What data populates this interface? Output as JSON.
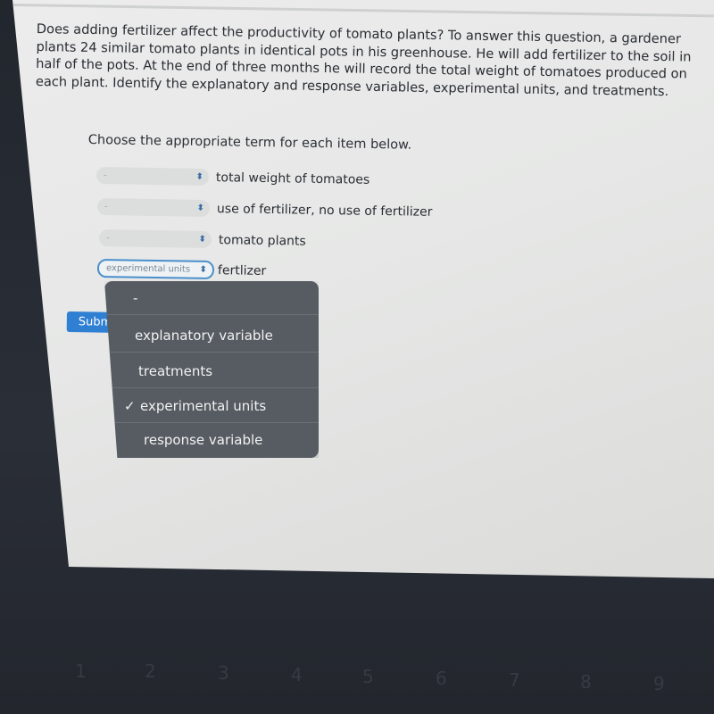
{
  "question": {
    "text": "Does adding fertilizer affect the productivity of tomato plants? To answer this question, a gardener plants 24 similar tomato plants in identical pots in his greenhouse. He will add fertilizer to the soil in half of the pots. At the end of three months he will record the total weight of tomatoes produced on each plant. Identify the explanatory and response variables, experimental units, and treatments."
  },
  "instructions": "Choose the appropriate term for each item below.",
  "items": [
    {
      "selected": "-",
      "label": "total weight of tomatoes"
    },
    {
      "selected": "-",
      "label": "use of fertilizer, no use of fertilizer"
    },
    {
      "selected": "-",
      "label": "tomato plants"
    },
    {
      "selected": "experimental units",
      "label": "fertlizer"
    }
  ],
  "select_icon": "chevron-up-down-icon",
  "submit_label": "Subm",
  "dropdown": {
    "options": [
      {
        "label": "-",
        "checked": false
      },
      {
        "label": "explanatory variable",
        "checked": false
      },
      {
        "label": "treatments",
        "checked": false
      },
      {
        "label": "experimental units",
        "checked": true
      },
      {
        "label": "response variable",
        "checked": false
      }
    ],
    "check_glyph": "✓"
  },
  "keyboard_keys": [
    "1",
    "2",
    "3",
    "4",
    "5",
    "6",
    "7",
    "8",
    "9"
  ]
}
